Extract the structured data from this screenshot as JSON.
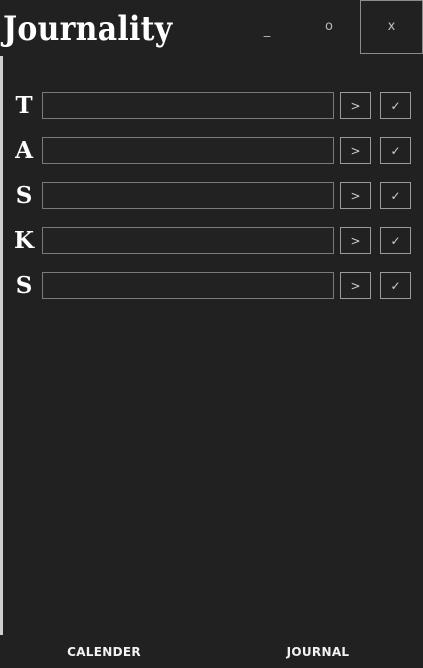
{
  "window": {
    "title": "Journality",
    "minimize_label": "_",
    "maximize_label": "o",
    "close_label": "x"
  },
  "tasks": {
    "rows": [
      {
        "letter": "T",
        "value": "",
        "forward_label": ">",
        "done_label": "✓"
      },
      {
        "letter": "A",
        "value": "",
        "forward_label": ">",
        "done_label": "✓"
      },
      {
        "letter": "S",
        "value": "",
        "forward_label": ">",
        "done_label": "✓"
      },
      {
        "letter": "K",
        "value": "",
        "forward_label": ">",
        "done_label": "✓"
      },
      {
        "letter": "S",
        "value": "",
        "forward_label": ">",
        "done_label": "✓"
      }
    ]
  },
  "footer": {
    "calender_label": "CALENDER",
    "journal_label": "JOURNAL"
  },
  "colors": {
    "background": "#212121",
    "text": "#ffffff",
    "border": "#7a7a7a",
    "rail": "#cfcfcf"
  }
}
